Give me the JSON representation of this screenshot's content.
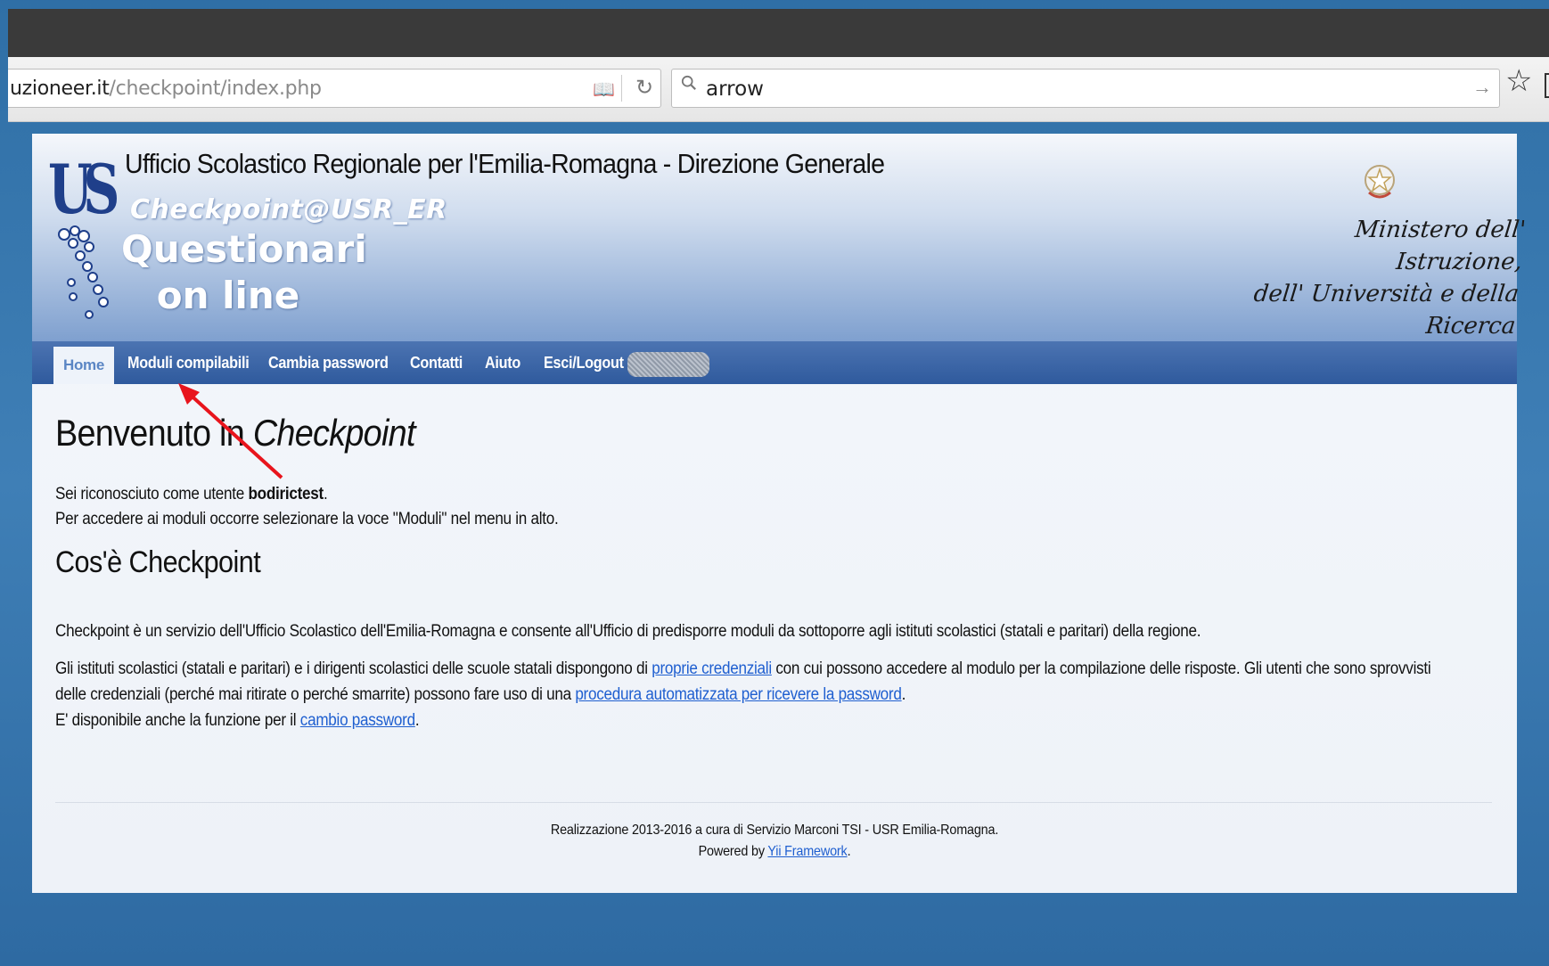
{
  "browser": {
    "url_domain": "uzioneer.it",
    "url_path": "/checkpoint/index.php",
    "search_value": "arrow",
    "icons": [
      "reader-view-icon",
      "reload-icon",
      "search-icon",
      "go-arrow-icon",
      "bookmark-star-icon"
    ]
  },
  "header": {
    "logo_text": "US",
    "org_title": "Ufficio Scolastico Regionale per l'Emilia-Romagna - Direzione Generale",
    "app_name": "Checkpoint@USR_ER",
    "tagline_line1": "Questionari",
    "tagline_line2": "on line",
    "ministry_line1": "Ministero dell' Istruzione,",
    "ministry_line2": "dell' Università e della Ricerca"
  },
  "menu": {
    "items": [
      {
        "label": "Home",
        "active": true
      },
      {
        "label": "Moduli compilabili"
      },
      {
        "label": "Cambia password"
      },
      {
        "label": "Contatti"
      },
      {
        "label": "Aiuto"
      },
      {
        "label": "Esci/Logout"
      }
    ]
  },
  "content": {
    "welcome_prefix": "Benvenuto in ",
    "welcome_em": "Checkpoint",
    "recognized_prefix": "Sei riconosciuto come utente ",
    "username": "bodirictest",
    "recognized_suffix": ".",
    "access_text": "Per accedere ai moduli occorre selezionare la voce \"Moduli\" nel menu in alto.",
    "about_title": "Cos'è Checkpoint",
    "about_p1": "Checkpoint è un servizio dell'Ufficio Scolastico dell'Emilia-Romagna e consente all'Ufficio di predisporre moduli da sottoporre agli istituti scolastici (statali e paritari) della regione.",
    "about_p2_a": "Gli istituti scolastici (statali e paritari) e i dirigenti scolastici delle scuole statali dispongono di ",
    "about_p2_link1": "proprie credenziali",
    "about_p2_b": " con cui possono accedere al modulo per la compilazione delle risposte. Gli utenti che sono sprovvisti",
    "about_p2_c": "delle credenziali (perché mai ritirate o perché smarrite) possono fare uso di una ",
    "about_p2_link2": "procedura automatizzata per ricevere la password",
    "about_p2_d": ".",
    "about_p3_a": "E' disponibile anche la funzione per il ",
    "about_p3_link": "cambio password",
    "about_p3_b": "."
  },
  "footer": {
    "line1": "Realizzazione 2013-2016 a cura di Servizio Marconi TSI - USR Emilia-Romagna.",
    "line2_prefix": "Powered by ",
    "line2_link": "Yii Framework",
    "line2_suffix": "."
  },
  "colors": {
    "annotation_arrow": "#e8141c",
    "link": "#1f5fd0",
    "menubar": "#3a64a8"
  }
}
